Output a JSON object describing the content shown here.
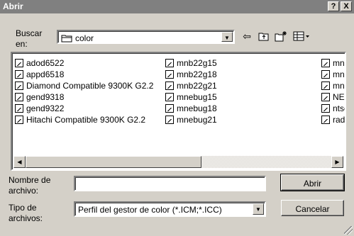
{
  "window": {
    "title": "Abrir",
    "help_label": "?",
    "close_label": "X"
  },
  "lookin": {
    "label_line1": "Buscar",
    "label_line2": "en:",
    "folder": "color"
  },
  "toolbar": {
    "back_icon": "⇦",
    "up_icon": "⮤",
    "newfolder_icon": "✶",
    "view_icon": "▦▾"
  },
  "files": {
    "col1": [
      "adod6522",
      "appd6518",
      "Diamond Compatible 9300K G2.2",
      "gend9318",
      "gend9322",
      "Hitachi Compatible 9300K G2.2"
    ],
    "col2": [
      "mnb22g15",
      "mnb22g18",
      "mnb22g21",
      "mnebug15",
      "mnebug18",
      "mnebug21"
    ],
    "col3": [
      "mnp",
      "mnp",
      "mnp",
      "NEC",
      "ntsc",
      "rad"
    ]
  },
  "filename": {
    "label_line1": "Nombre de",
    "label_line2": "archivo:",
    "value": ""
  },
  "filetype": {
    "label_line1": "Tipo de",
    "label_line2": "archivos:",
    "value": "Perfil del gestor de color  (*.ICM;*.ICC)"
  },
  "buttons": {
    "open": "Abrir",
    "cancel": "Cancelar"
  }
}
